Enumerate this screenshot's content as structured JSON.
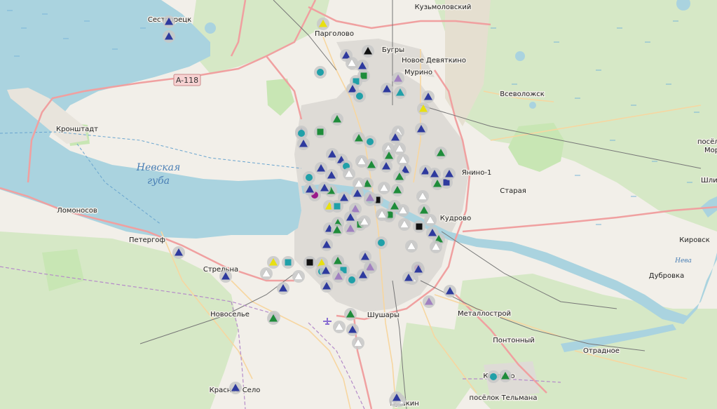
{
  "map": {
    "colors": {
      "land": "#f2efe9",
      "water": "#aad3df",
      "forest": "#d6e8c6",
      "park": "#c8e6b4",
      "urban": "#dedbd6",
      "major_road": "#f0a0a0",
      "road": "#f7d6a0",
      "rail": "#777777",
      "marker_halo": "#c8c8c8"
    },
    "water_labels": [
      "Невская",
      "губа"
    ],
    "road_shield": "A-118",
    "river_label": "Нева",
    "places": [
      {
        "id": "sestroretsk",
        "name": "Сестрорецк"
      },
      {
        "id": "pargolovo",
        "name": "Парголово"
      },
      {
        "id": "kuzmolovsky",
        "name": "Кузьмоловский"
      },
      {
        "id": "bugry",
        "name": "Бугры"
      },
      {
        "id": "novoe-devyatkino",
        "name": "Новое Девяткино"
      },
      {
        "id": "murino",
        "name": "Мурино"
      },
      {
        "id": "vsevolozhsk",
        "name": "Всеволожск"
      },
      {
        "id": "kronshtadt",
        "name": "Кронштадт"
      },
      {
        "id": "lomonosov",
        "name": "Ломоносов"
      },
      {
        "id": "peterhof",
        "name": "Петергоф"
      },
      {
        "id": "strelna",
        "name": "Стрельна"
      },
      {
        "id": "novoselye",
        "name": "Новоселье"
      },
      {
        "id": "shushary",
        "name": "Шушары"
      },
      {
        "id": "kudrovo",
        "name": "Кудрово"
      },
      {
        "id": "yanino",
        "name": "Янино-1"
      },
      {
        "id": "staraya",
        "name": "Старая"
      },
      {
        "id": "metallostroy",
        "name": "Металлострой"
      },
      {
        "id": "pontonny",
        "name": "Понтонный"
      },
      {
        "id": "otradnoe",
        "name": "Отрадное"
      },
      {
        "id": "kirovsk",
        "name": "Кировск"
      },
      {
        "id": "dubrovka",
        "name": "Дубровка"
      },
      {
        "id": "shlisselburg",
        "name": "Шлисс"
      },
      {
        "id": "poselok-mo",
        "name": "посёло"
      },
      {
        "id": "mo",
        "name": "Мор"
      },
      {
        "id": "kolpino",
        "name": "Колпино"
      },
      {
        "id": "poselok-telmana",
        "name": "посёлок Тельмана"
      },
      {
        "id": "krasnoe-selo",
        "name": "Красное Село"
      },
      {
        "id": "pushkin",
        "name": "Пушкин"
      }
    ],
    "markers": [
      {
        "type": "triangle",
        "color": "#2e3a9e"
      },
      {
        "type": "triangle",
        "color": "#2e3a9e"
      },
      {
        "type": "triangle",
        "color": "#e8e010"
      },
      {
        "type": "triangle",
        "color": "#111111"
      },
      {
        "type": "triangle",
        "color": "#2e3a9e"
      },
      {
        "type": "triangle",
        "color": "#ffffff"
      },
      {
        "type": "square",
        "color": "#1e8c3a"
      },
      {
        "type": "circle",
        "color": "#20a0a8"
      },
      {
        "type": "triangle",
        "color": "#2e3a9e"
      },
      {
        "type": "square",
        "color": "#20a0a8"
      },
      {
        "type": "triangle",
        "color": "#2e3a9e"
      },
      {
        "type": "circle",
        "color": "#20a0a8"
      },
      {
        "type": "triangle",
        "color": "#a080c0"
      },
      {
        "type": "triangle",
        "color": "#2e3a9e"
      },
      {
        "type": "triangle",
        "color": "#20a0a8"
      },
      {
        "type": "triangle",
        "color": "#2e3a9e"
      },
      {
        "type": "triangle",
        "color": "#e8e010"
      },
      {
        "type": "triangle",
        "color": "#2e3a9e"
      },
      {
        "type": "triangle",
        "color": "#2e3a9e"
      },
      {
        "type": "circle",
        "color": "#20a0a8"
      },
      {
        "type": "square",
        "color": "#1e8c3a"
      },
      {
        "type": "triangle",
        "color": "#1e8c3a"
      },
      {
        "type": "triangle",
        "color": "#2e3a9e"
      },
      {
        "type": "triangle",
        "color": "#1e8c3a"
      },
      {
        "type": "triangle",
        "color": "#ffffff"
      },
      {
        "type": "triangle",
        "color": "#2e3a9e"
      },
      {
        "type": "triangle",
        "color": "#ffffff"
      },
      {
        "type": "triangle",
        "color": "#1e8c3a"
      },
      {
        "type": "triangle",
        "color": "#2e3a9e"
      },
      {
        "type": "circle",
        "color": "#20a0a8"
      },
      {
        "type": "triangle",
        "color": "#2e3a9e"
      },
      {
        "type": "triangle",
        "color": "#ffffff"
      },
      {
        "type": "triangle",
        "color": "#1e8c3a"
      },
      {
        "type": "triangle",
        "color": "#2e3a9e"
      },
      {
        "type": "circle",
        "color": "#20a0a8"
      },
      {
        "type": "triangle",
        "color": "#2e3a9e"
      },
      {
        "type": "triangle",
        "color": "#ffffff"
      },
      {
        "type": "triangle",
        "color": "#1e8c3a"
      },
      {
        "type": "triangle",
        "color": "#2e3a9e"
      },
      {
        "type": "triangle",
        "color": "#ffffff"
      },
      {
        "type": "circle",
        "color": "#20a0a8"
      },
      {
        "type": "circle",
        "color": "#9a1a8a"
      },
      {
        "type": "triangle",
        "color": "#1e8c3a"
      },
      {
        "type": "triangle",
        "color": "#ffffff"
      },
      {
        "type": "triangle",
        "color": "#2e3a9e"
      },
      {
        "type": "triangle",
        "color": "#1e8c3a"
      },
      {
        "type": "square",
        "color": "#111111"
      },
      {
        "type": "triangle",
        "color": "#ffffff"
      },
      {
        "type": "triangle",
        "color": "#2e3a9e"
      },
      {
        "type": "triangle",
        "color": "#1e8c3a"
      },
      {
        "type": "square",
        "color": "#1e8c3a"
      },
      {
        "type": "triangle",
        "color": "#ffffff"
      },
      {
        "type": "triangle",
        "color": "#e8e010"
      },
      {
        "type": "triangle",
        "color": "#2e3a9e"
      },
      {
        "type": "square",
        "color": "#20a0a8"
      },
      {
        "type": "triangle",
        "color": "#a080c0"
      },
      {
        "type": "triangle",
        "color": "#2e3a9e"
      },
      {
        "type": "circle",
        "color": "#20a0a8"
      },
      {
        "type": "square",
        "color": "#1e8c3a"
      },
      {
        "type": "triangle",
        "color": "#1e8c3a"
      },
      {
        "type": "triangle",
        "color": "#2e3a9e"
      },
      {
        "type": "triangle",
        "color": "#ffffff"
      },
      {
        "type": "triangle",
        "color": "#1e8c3a"
      },
      {
        "type": "square",
        "color": "#111111"
      },
      {
        "type": "triangle",
        "color": "#ffffff"
      },
      {
        "type": "triangle",
        "color": "#2e3a9e"
      },
      {
        "type": "triangle",
        "color": "#1e8c3a"
      },
      {
        "type": "triangle",
        "color": "#2e3a9e"
      },
      {
        "type": "square",
        "color": "#2e3a9e"
      },
      {
        "type": "triangle",
        "color": "#2e3a9e"
      },
      {
        "type": "triangle",
        "color": "#1e8c3a"
      },
      {
        "type": "triangle",
        "color": "#ffffff"
      },
      {
        "type": "triangle",
        "color": "#2e3a9e"
      },
      {
        "type": "triangle",
        "color": "#ffffff"
      },
      {
        "type": "square",
        "color": "#1e8c3a"
      },
      {
        "type": "triangle",
        "color": "#1e8c3a"
      },
      {
        "type": "square",
        "color": "#111111"
      },
      {
        "type": "triangle",
        "color": "#ffffff"
      },
      {
        "type": "triangle",
        "color": "#a080c0"
      },
      {
        "type": "triangle",
        "color": "#2e3a9e"
      },
      {
        "type": "triangle",
        "color": "#1e8c3a"
      },
      {
        "type": "triangle",
        "color": "#ffffff"
      },
      {
        "type": "triangle",
        "color": "#2e3a9e"
      },
      {
        "type": "triangle",
        "color": "#1e8c3a"
      },
      {
        "type": "triangle",
        "color": "#a080c0"
      },
      {
        "type": "triangle",
        "color": "#2e3a9e"
      },
      {
        "type": "circle",
        "color": "#20a0a8"
      },
      {
        "type": "triangle",
        "color": "#2e3a9e"
      },
      {
        "type": "triangle",
        "color": "#1e8c3a"
      },
      {
        "type": "triangle",
        "color": "#a080c0"
      },
      {
        "type": "triangle",
        "color": "#ffffff"
      },
      {
        "type": "circle",
        "color": "#9a1a8a"
      },
      {
        "type": "triangle",
        "color": "#ffffff"
      },
      {
        "type": "triangle",
        "color": "#2e3a9e"
      },
      {
        "type": "triangle",
        "color": "#a080c0"
      },
      {
        "type": "triangle",
        "color": "#2e3a9e"
      },
      {
        "type": "triangle",
        "color": "#e8e010"
      },
      {
        "type": "square",
        "color": "#20a0a8"
      },
      {
        "type": "triangle",
        "color": "#2e3a9e"
      },
      {
        "type": "triangle",
        "color": "#ffffff"
      },
      {
        "type": "triangle",
        "color": "#2e3a9e"
      },
      {
        "type": "triangle",
        "color": "#ffffff"
      },
      {
        "type": "square",
        "color": "#111111"
      },
      {
        "type": "triangle",
        "color": "#e8e010"
      },
      {
        "type": "circle",
        "color": "#20a0a8"
      },
      {
        "type": "triangle",
        "color": "#ffffff"
      },
      {
        "type": "square",
        "color": "#20a0a8"
      },
      {
        "type": "triangle",
        "color": "#1e8c3a"
      },
      {
        "type": "circle",
        "color": "#20a0a8"
      },
      {
        "type": "triangle",
        "color": "#2e3a9e"
      },
      {
        "type": "triangle",
        "color": "#a080c0"
      },
      {
        "type": "triangle",
        "color": "#2e3a9e"
      },
      {
        "type": "triangle",
        "color": "#ffffff"
      },
      {
        "type": "triangle",
        "color": "#ffffff"
      },
      {
        "type": "triangle",
        "color": "#2e3a9e"
      },
      {
        "type": "triangle",
        "color": "#1e8c3a"
      },
      {
        "type": "triangle",
        "color": "#a080c0"
      },
      {
        "type": "triangle",
        "color": "#2e3a9e"
      },
      {
        "type": "triangle",
        "color": "#a080c0"
      },
      {
        "type": "triangle",
        "color": "#2e3a9e"
      },
      {
        "type": "circle",
        "color": "#20a0a8"
      },
      {
        "type": "triangle",
        "color": "#ffffff"
      },
      {
        "type": "triangle",
        "color": "#1e8c3a"
      },
      {
        "type": "triangle",
        "color": "#2e3a9e"
      },
      {
        "type": "triangle",
        "color": "#ffffff"
      },
      {
        "type": "triangle",
        "color": "#2e3a9e"
      },
      {
        "type": "triangle",
        "color": "#ffffff"
      },
      {
        "type": "triangle",
        "color": "#1e8c3a"
      },
      {
        "type": "triangle",
        "color": "#2e3a9e"
      }
    ]
  }
}
